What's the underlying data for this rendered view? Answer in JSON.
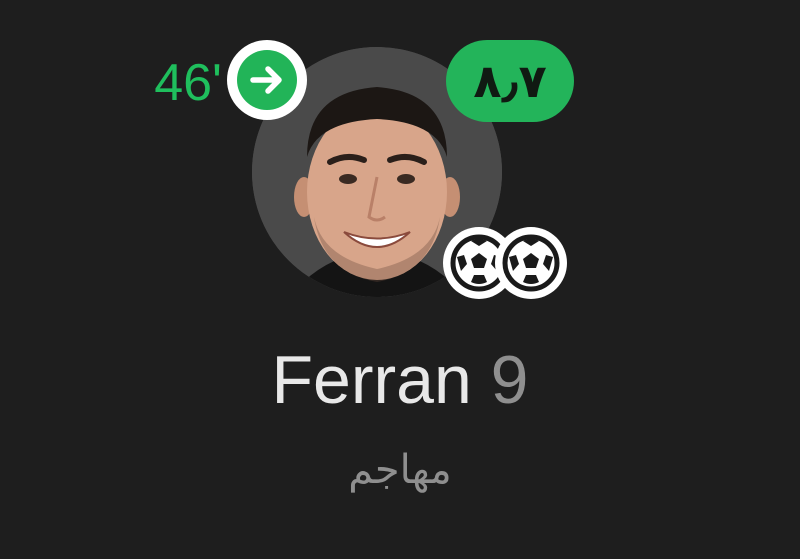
{
  "player": {
    "name": "Ferran",
    "shirt_number": "9",
    "position": "مهاجم",
    "photo": "player-portrait"
  },
  "substitution": {
    "minute": "46'",
    "icon": "arrow-right-icon"
  },
  "rating": {
    "value": "٨٫٧",
    "color": "#23b45a"
  },
  "goals": {
    "count": 2,
    "icon": "football-icon"
  },
  "colors": {
    "background": "#1e1e1e",
    "accent": "#1fbf5d"
  }
}
